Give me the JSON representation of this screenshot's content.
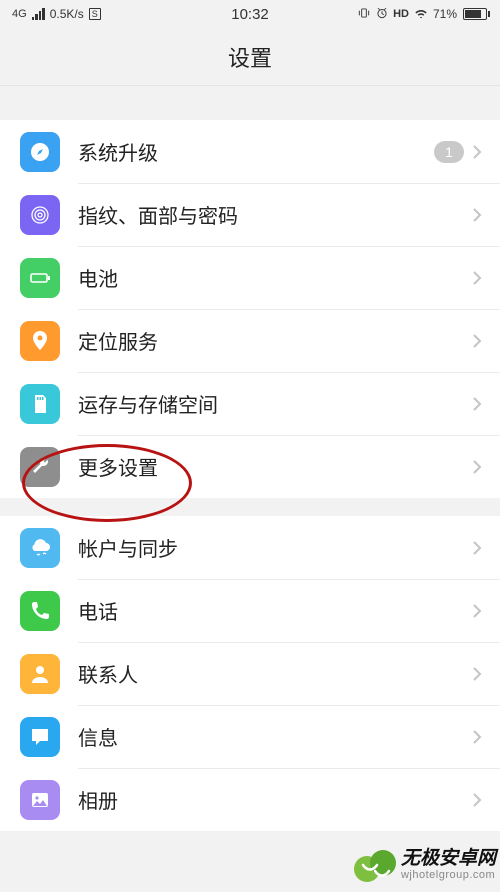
{
  "statusbar": {
    "network_type": "4G",
    "speed": "0.5K/s",
    "sim": "S",
    "time": "10:32",
    "hd": "HD",
    "battery_pct": "71%"
  },
  "header": {
    "title": "设置"
  },
  "groups": [
    {
      "key": "g1",
      "items": [
        {
          "key": "upgrade",
          "label": "系统升级",
          "icon": "compass-icon",
          "bg": "bg-blue",
          "badge": "1"
        },
        {
          "key": "security",
          "label": "指纹、面部与密码",
          "icon": "fingerprint-icon",
          "bg": "bg-purple"
        },
        {
          "key": "battery",
          "label": "电池",
          "icon": "battery-icon",
          "bg": "bg-green"
        },
        {
          "key": "location",
          "label": "定位服务",
          "icon": "location-icon",
          "bg": "bg-orange"
        },
        {
          "key": "storage",
          "label": "运存与存储空间",
          "icon": "sdcard-icon",
          "bg": "bg-teal"
        },
        {
          "key": "more",
          "label": "更多设置",
          "icon": "wrench-icon",
          "bg": "bg-gray"
        }
      ]
    },
    {
      "key": "g2",
      "items": [
        {
          "key": "accounts",
          "label": "帐户与同步",
          "icon": "cloud-icon",
          "bg": "bg-sky"
        },
        {
          "key": "phone",
          "label": "电话",
          "icon": "phone-icon",
          "bg": "bg-call"
        },
        {
          "key": "contacts",
          "label": "联系人",
          "icon": "person-icon",
          "bg": "bg-amber"
        },
        {
          "key": "messages",
          "label": "信息",
          "icon": "message-icon",
          "bg": "bg-message"
        },
        {
          "key": "gallery",
          "label": "相册",
          "icon": "gallery-icon",
          "bg": "bg-lilac"
        }
      ]
    }
  ],
  "watermark": {
    "title": "无极安卓网",
    "sub": "wjhotelgroup.com"
  }
}
